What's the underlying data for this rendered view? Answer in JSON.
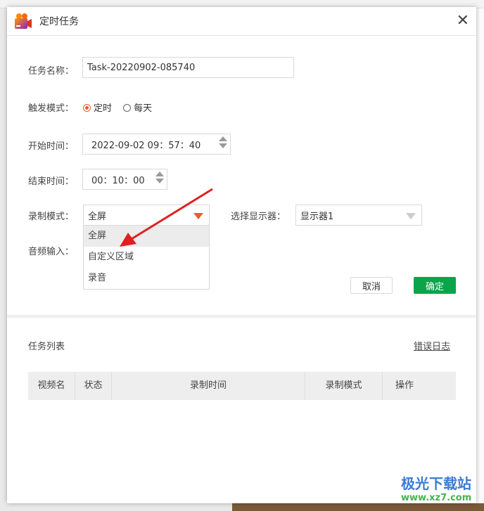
{
  "dialog": {
    "title": "定时任务",
    "app_icon": "video-camera-icon",
    "close_icon": "close-icon"
  },
  "form": {
    "task_name_label": "任务名称：",
    "task_name_value": "Task-20220902-085740",
    "trigger_label": "触发模式：",
    "trigger_options": [
      {
        "label": "定时",
        "selected": true
      },
      {
        "label": "每天",
        "selected": false
      }
    ],
    "start_label": "开始时间：",
    "start_value": "2022-09-02 09：57：40",
    "end_label": "结束时间：",
    "end_value": "00：10：00",
    "mode_label": "录制模式：",
    "mode_value": "全屏",
    "mode_options": [
      "全屏",
      "自定义区域",
      "录音"
    ],
    "monitor_label": "选择显示器：",
    "monitor_value": "显示器1",
    "audio_label": "音频输入：",
    "cancel": "取消",
    "confirm": "确定"
  },
  "task_list": {
    "title": "任务列表",
    "error_log": "错误日志",
    "columns": [
      "视频名",
      "状态",
      "录制时间",
      "录制模式",
      "操作"
    ]
  },
  "colors": {
    "accent": "#f05a28",
    "confirm": "#0aa54a",
    "arrow": "#e02020"
  },
  "watermark": {
    "name": "极光下载站",
    "url": "www.xz7.com"
  }
}
